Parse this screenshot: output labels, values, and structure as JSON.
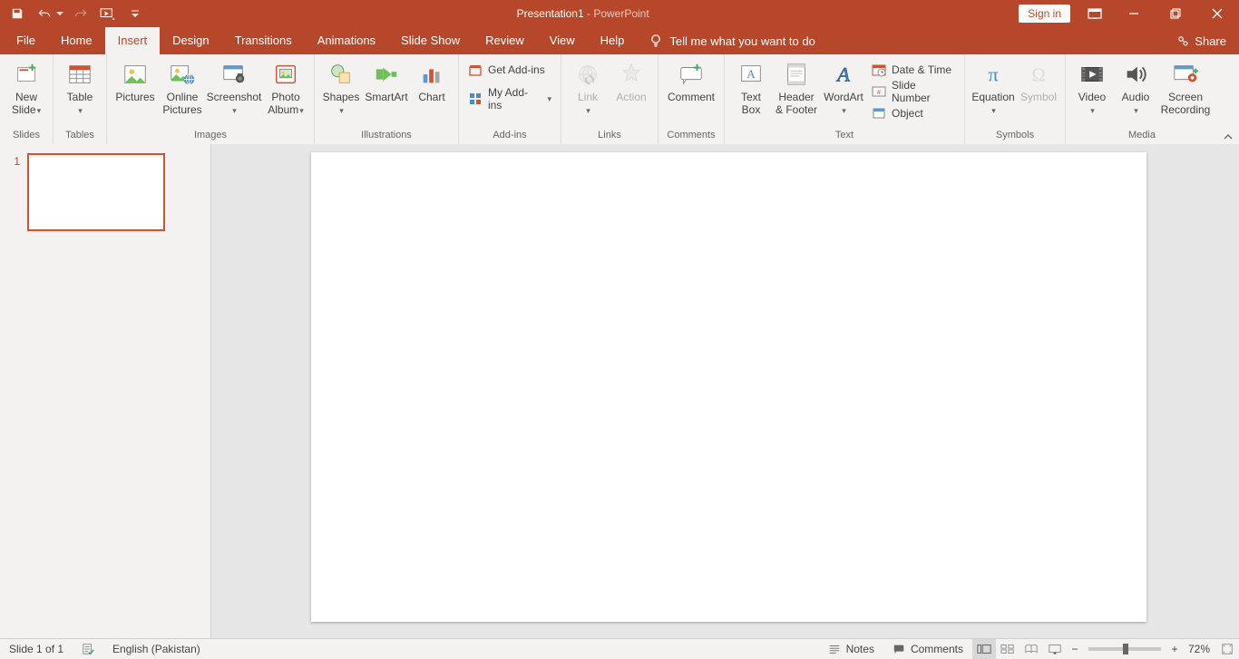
{
  "title": {
    "doc": "Presentation1",
    "sep": "  -  ",
    "app": "PowerPoint"
  },
  "signin": "Sign in",
  "tabs": {
    "file": "File",
    "home": "Home",
    "insert": "Insert",
    "design": "Design",
    "transitions": "Transitions",
    "animations": "Animations",
    "slideshow": "Slide Show",
    "review": "Review",
    "view": "View",
    "help": "Help",
    "tellme": "Tell me what you want to do",
    "share": "Share"
  },
  "ribbon": {
    "groups": {
      "slides": "Slides",
      "tables": "Tables",
      "images": "Images",
      "illustrations": "Illustrations",
      "addins": "Add-ins",
      "links": "Links",
      "comments": "Comments",
      "text": "Text",
      "symbols": "Symbols",
      "media": "Media"
    },
    "buttons": {
      "newslide": "New\nSlide",
      "table": "Table",
      "pictures": "Pictures",
      "onlinepics": "Online\nPictures",
      "screenshot": "Screenshot",
      "photoalbum": "Photo\nAlbum",
      "shapes": "Shapes",
      "smartart": "SmartArt",
      "chart": "Chart",
      "getaddins": "Get Add-ins",
      "myaddins": "My Add-ins",
      "link": "Link",
      "action": "Action",
      "comment": "Comment",
      "textbox": "Text\nBox",
      "headerfooter": "Header\n& Footer",
      "wordart": "WordArt",
      "datetime": "Date & Time",
      "slidenumber": "Slide Number",
      "object": "Object",
      "equation": "Equation",
      "symbol": "Symbol",
      "video": "Video",
      "audio": "Audio",
      "screenrec": "Screen\nRecording"
    }
  },
  "thumbnail": {
    "num": "1"
  },
  "status": {
    "slide": "Slide 1 of 1",
    "lang": "English (Pakistan)",
    "notes": "Notes",
    "comments": "Comments",
    "zoom": "72%"
  }
}
